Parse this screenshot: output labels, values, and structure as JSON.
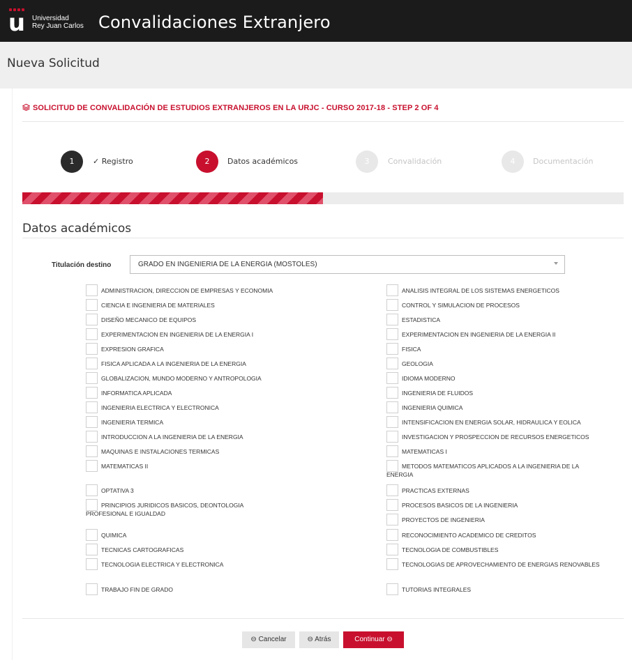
{
  "header": {
    "logo_letter": "u",
    "university_line1": "Universidad",
    "university_line2": "Rey Juan Carlos",
    "app_title": "Convalidaciones Extranjero"
  },
  "subheader": {
    "title": "Nueva Solicitud"
  },
  "panel": {
    "caption": "SOLICITUD DE CONVALIDACIÓN DE ESTUDIOS EXTRANJEROS EN LA URJC - CURSO 2017-18 - STEP 2 OF 4"
  },
  "steps": [
    {
      "number": "1",
      "label": "✓ Registro",
      "state": "done"
    },
    {
      "number": "2",
      "label": "Datos académicos",
      "state": "active"
    },
    {
      "number": "3",
      "label": "Convalidación",
      "state": "pending"
    },
    {
      "number": "4",
      "label": "Documentación",
      "state": "pending"
    }
  ],
  "progress": {
    "value": 0.5
  },
  "section": {
    "title": "Datos académicos",
    "field_label": "Titulación destino",
    "selected_degree": "GRADO EN INGENIERIA DE LA ENERGIA (MOSTOLES)"
  },
  "subjects_left": [
    "ADMINISTRACION, DIRECCION DE EMPRESAS Y ECONOMIA",
    "CIENCIA E INGENIERIA DE MATERIALES",
    "DISEÑO MECANICO DE EQUIPOS",
    "EXPERIMENTACION EN INGENIERIA DE LA ENERGIA I",
    "EXPRESION GRAFICA",
    "FISICA APLICADA A LA INGENIERIA DE LA ENERGIA",
    "GLOBALIZACION, MUNDO MODERNO Y ANTROPOLOGIA",
    "INFORMATICA APLICADA",
    "INGENIERIA ELECTRICA Y ELECTRONICA",
    "INGENIERIA TERMICA",
    "INTRODUCCION A LA INGENIERIA DE LA ENERGIA",
    "MAQUINAS E INSTALACIONES TERMICAS",
    "MATEMATICAS II",
    "OPTATIVA 3",
    "PRINCIPIOS JURIDICOS BASICOS, DEONTOLOGIA PROFESIONAL E IGUALDAD",
    "QUIMICA",
    "TECNICAS CARTOGRAFICAS",
    "TECNOLOGIA ELECTRICA Y ELECTRONICA",
    "TRABAJO FIN DE GRADO"
  ],
  "subjects_right": [
    "ANALISIS INTEGRAL DE LOS SISTEMAS ENERGETICOS",
    "CONTROL Y SIMULACION DE PROCESOS",
    "ESTADISTICA",
    "EXPERIMENTACION EN INGENIERIA DE LA ENERGIA II",
    "FISICA",
    "GEOLOGIA",
    "IDIOMA MODERNO",
    "INGENIERIA DE FLUIDOS",
    "INGENIERIA QUIMICA",
    "INTENSIFICACION EN ENERGIA SOLAR, HIDRAULICA Y EOLICA",
    "INVESTIGACION Y PROSPECCION DE RECURSOS ENERGETICOS",
    "MATEMATICAS I",
    "METODOS MATEMATICOS APLICADOS A LA INGENIERIA DE LA ENERGIA",
    "PRACTICAS EXTERNAS",
    "PROCESOS BASICOS DE LA INGENIERIA",
    "PROYECTOS DE INGENIERIA",
    "RECONOCIMIENTO ACADEMICO DE CREDITOS",
    "TECNOLOGIA DE COMBUSTIBLES",
    "TECNOLOGIAS DE APROVECHAMIENTO DE ENERGIAS RENOVABLES",
    "TUTORIAS INTEGRALES"
  ],
  "buttons": {
    "cancel": "Cancelar",
    "back": "Atrás",
    "continue": "Continuar"
  },
  "icons": {
    "caption": "stack-icon",
    "cancel": "circle-arrow-left-icon",
    "back": "circle-arrow-left-icon",
    "continue": "circle-arrow-right-icon"
  },
  "colors": {
    "brand_red": "#c8102e",
    "topbar": "#1b1b1b",
    "step_done": "#2b2b2b",
    "step_pending": "#e8e8e8"
  }
}
